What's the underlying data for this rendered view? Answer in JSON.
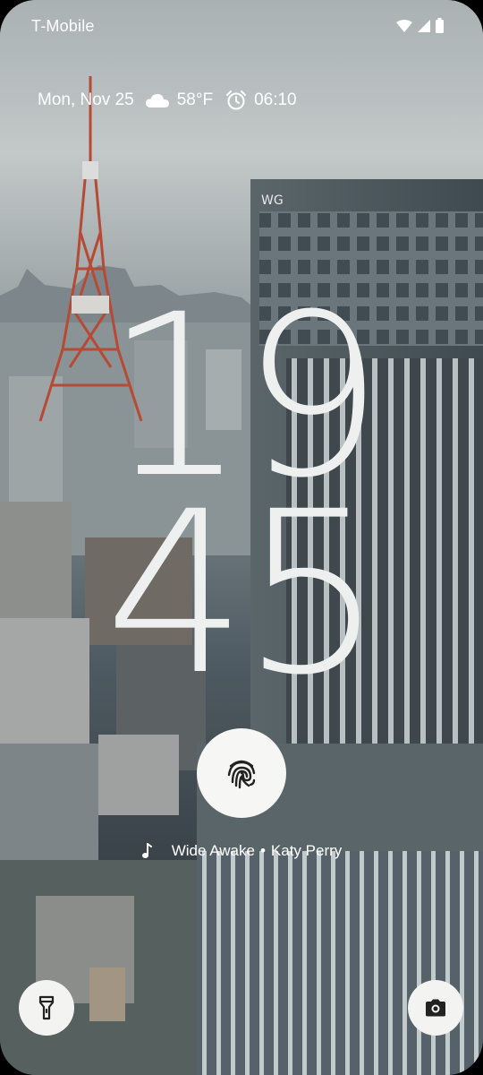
{
  "status_bar": {
    "carrier": "T-Mobile",
    "icons": [
      "wifi-icon",
      "signal-icon",
      "battery-icon"
    ]
  },
  "info_row": {
    "date": "Mon, Nov 25",
    "weather_icon": "cloud-icon",
    "temperature": "58°F",
    "alarm_icon": "alarm-clock-icon",
    "alarm_time": "06:10"
  },
  "clock": {
    "hours": "19",
    "minutes": "45"
  },
  "unlock": {
    "icon": "fingerprint-icon"
  },
  "now_playing": {
    "icon": "music-note-icon",
    "song": "Wide Awake",
    "separator": "•",
    "artist": "Katy Perry"
  },
  "shortcuts": {
    "left_icon": "flashlight-icon",
    "right_icon": "camera-icon"
  },
  "colors": {
    "text": "#ffffff",
    "clock": "#eef0ef",
    "button_bg": "#f3f3f1"
  }
}
